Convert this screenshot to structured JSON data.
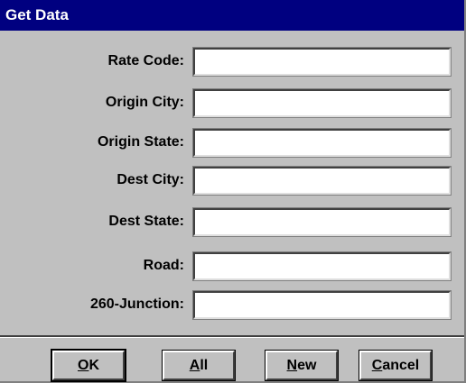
{
  "window": {
    "title": "Get Data"
  },
  "fields": [
    {
      "label": "Rate Code:",
      "value": ""
    },
    {
      "label": "Origin City:",
      "value": ""
    },
    {
      "label": "Origin State:",
      "value": ""
    },
    {
      "label": "Dest City:",
      "value": ""
    },
    {
      "label": "Dest State:",
      "value": ""
    },
    {
      "label": "Road:",
      "value": ""
    },
    {
      "label": "260-Junction:",
      "value": ""
    }
  ],
  "buttons": {
    "ok": {
      "mnemonic": "O",
      "rest": "K"
    },
    "all": {
      "mnemonic": "A",
      "rest": "ll"
    },
    "new": {
      "mnemonic": "N",
      "rest": "ew"
    },
    "cancel": {
      "mnemonic": "C",
      "rest": "ancel"
    }
  },
  "colors": {
    "titlebar": "#000080",
    "face": "#c0c0c0"
  }
}
